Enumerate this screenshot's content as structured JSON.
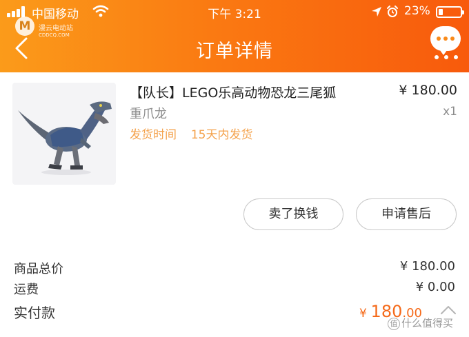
{
  "status_bar": {
    "carrier": "中国移动",
    "time": "下午 3:21",
    "battery": "23%"
  },
  "watermark": {
    "logo_letter": "M",
    "site_text": "漫云电动站",
    "site_url": "CDDCQ.COM",
    "bottom_text": "什么值得买",
    "bottom_mark": "值"
  },
  "nav": {
    "title": "订单详情"
  },
  "product": {
    "title": "【队长】LEGO乐高动物恐龙三尾狐",
    "price": "¥ 180.00",
    "spec": "重爪龙",
    "quantity": "x1",
    "ship_label": "发货时间",
    "ship_value": "15天内发货"
  },
  "actions": {
    "sell": "卖了换钱",
    "after_sale": "申请售后"
  },
  "summary": {
    "goods_total_label": "商品总价",
    "goods_total_value": "¥ 180.00",
    "shipping_label": "运费",
    "shipping_value": "¥ 0.00",
    "paid_label": "实付款",
    "paid_currency": "¥",
    "paid_integer": "180",
    "paid_decimal": ".00"
  },
  "colors": {
    "header_start": "#fb9b1a",
    "header_end": "#f85a0c",
    "accent": "#f56a1a",
    "ship_text": "#f4a24c"
  }
}
